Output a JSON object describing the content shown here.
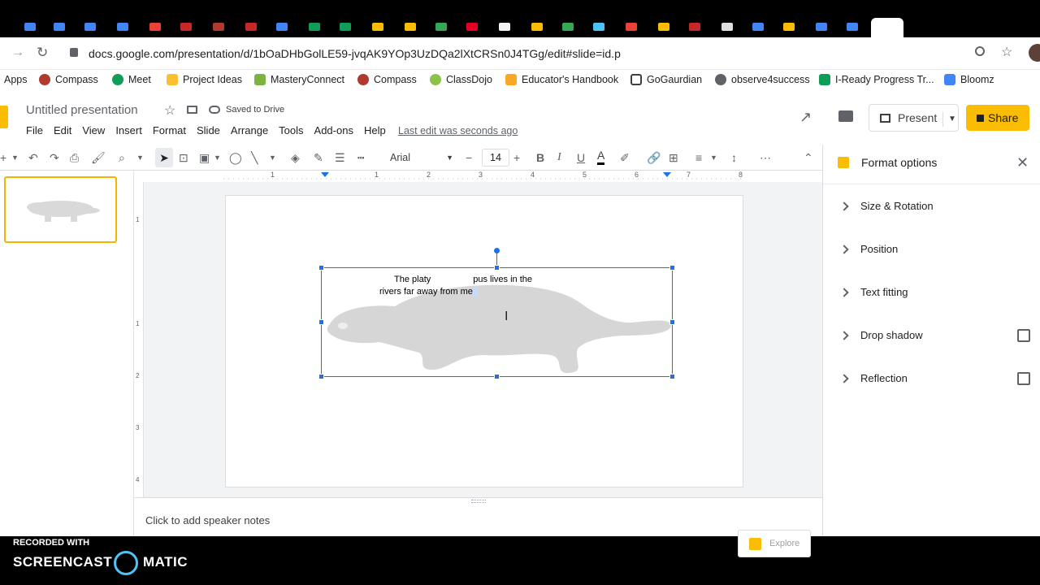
{
  "browser": {
    "url": "docs.google.com/presentation/d/1bOaDHbGolLE59-jvqAK9YOp3UzDQa2lXtCRSn0J4TGg/edit#slide=id.p",
    "bookmarks": [
      {
        "label": "Apps",
        "color": "#4285f4"
      },
      {
        "label": "Compass",
        "color": "#b03a2e"
      },
      {
        "label": "Meet",
        "color": "#0f9d58"
      },
      {
        "label": "Project Ideas",
        "color": "#fbc02d"
      },
      {
        "label": "MasteryConnect",
        "color": "#7cb342"
      },
      {
        "label": "Compass",
        "color": "#b03a2e"
      },
      {
        "label": "ClassDojo",
        "color": "#8bc34a"
      },
      {
        "label": "Educator's Handbook",
        "color": "#f9a825"
      },
      {
        "label": "GoGaurdian",
        "color": "#3c4043"
      },
      {
        "label": "observe4success",
        "color": "#5f6368"
      },
      {
        "label": "I-Ready Progress Tr...",
        "color": "#0f9d58"
      },
      {
        "label": "Bloomz",
        "color": "#4285f4"
      }
    ]
  },
  "app": {
    "title": "Untitled presentation",
    "saved": "Saved to Drive",
    "menu": [
      "File",
      "Edit",
      "View",
      "Insert",
      "Format",
      "Slide",
      "Arrange",
      "Tools",
      "Add-ons",
      "Help"
    ],
    "last_edit": "Last edit was seconds ago",
    "present_label": "Present",
    "share_label": "Share",
    "accent": "#fbbc04"
  },
  "toolbar": {
    "font": "Arial",
    "font_size": "14"
  },
  "ruler": {
    "ticks": [
      "1",
      "1",
      "2",
      "3",
      "4",
      "5",
      "6",
      "7",
      "8"
    ]
  },
  "vruler": {
    "ticks": [
      "1",
      "1",
      "2",
      "3",
      "4"
    ]
  },
  "slide": {
    "text_line1": "The platy",
    "text_line1b": "pus lives in the",
    "text_line2": "rivers far away from me"
  },
  "notes": {
    "placeholder": "Click to add speaker notes"
  },
  "explore_label": "Explore",
  "panel": {
    "title": "Format options",
    "sections": [
      "Size & Rotation",
      "Position",
      "Text fitting",
      "Drop shadow",
      "Reflection"
    ]
  },
  "watermark": {
    "line1": "RECORDED WITH",
    "line2a": "SCREENCAST",
    "line2b": "MATIC"
  }
}
